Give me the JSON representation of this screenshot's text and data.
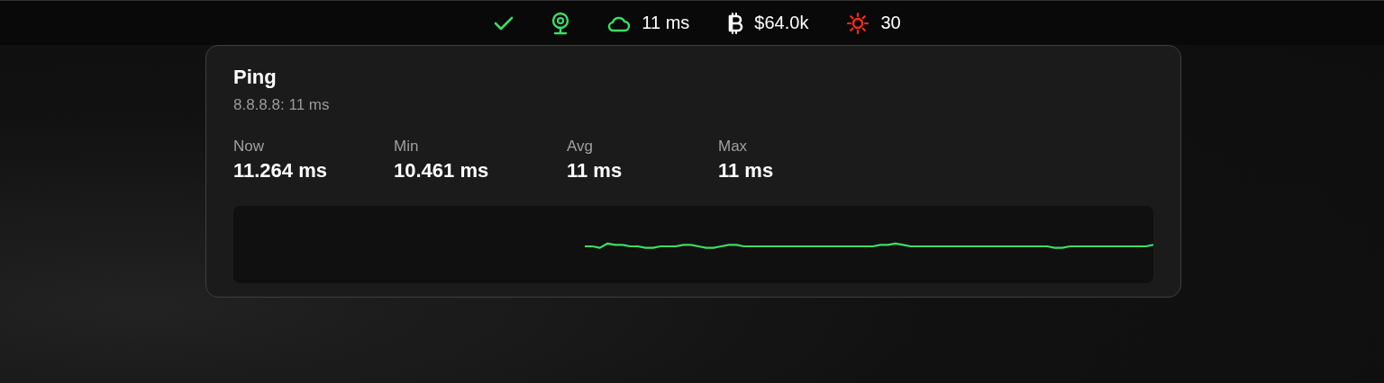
{
  "menu_bar": {
    "items": [
      {
        "kind": "check"
      },
      {
        "kind": "webcam"
      },
      {
        "kind": "cloud",
        "text": "11 ms"
      },
      {
        "kind": "bitcoin",
        "text": "$64.0k"
      },
      {
        "kind": "sun",
        "text": "30"
      }
    ]
  },
  "card": {
    "title": "Ping",
    "subtitle": "8.8.8.8: 11 ms",
    "stats": [
      {
        "label": "Now",
        "value": "11.264 ms"
      },
      {
        "label": "Min",
        "value": "10.461 ms"
      },
      {
        "label": "Avg",
        "value": "11 ms"
      },
      {
        "label": "Max",
        "value": "11 ms"
      }
    ]
  }
}
